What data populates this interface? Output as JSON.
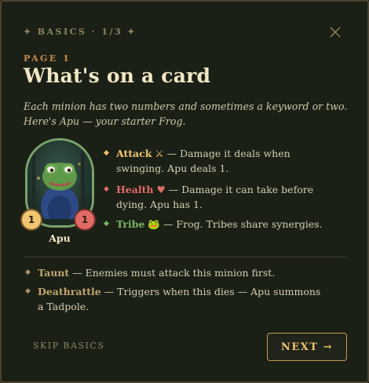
{
  "header": {
    "eyebrow": "BASICS · 1/3",
    "star_icon": "✦",
    "close_icon": "close-icon"
  },
  "page": {
    "label": "PAGE 1",
    "title": "What's on a card",
    "intro": "Each minion has two numbers and sometimes a keyword or two. Here's Apu — your starter Frog."
  },
  "minion": {
    "name": "Apu",
    "attack": "1",
    "health": "1",
    "portrait_icon": "frog-portrait"
  },
  "stats": [
    {
      "keyword": "Attack",
      "glyph": "⚔",
      "desc": " — Damage it deals when swinging. Apu deals 1."
    },
    {
      "keyword": "Health",
      "glyph": "♥",
      "desc": " — Damage it can take before dying. Apu has 1."
    },
    {
      "keyword": "Tribe",
      "glyph": "🐸",
      "desc": " — Frog. Tribes share synergies."
    }
  ],
  "keywords": [
    {
      "keyword": "Taunt",
      "desc": " — Enemies must attack this minion first."
    },
    {
      "keyword": "Deathrattle",
      "desc": " — Triggers when this dies — Apu summons a Tadpole."
    }
  ],
  "actions": {
    "skip": "SKIP BASICS",
    "next": "NEXT →"
  },
  "colors": {
    "background": "#1b2016",
    "attack": "#f0c570",
    "health": "#e06b66",
    "tribe": "#7bb468",
    "accent": "#c98b4c"
  }
}
